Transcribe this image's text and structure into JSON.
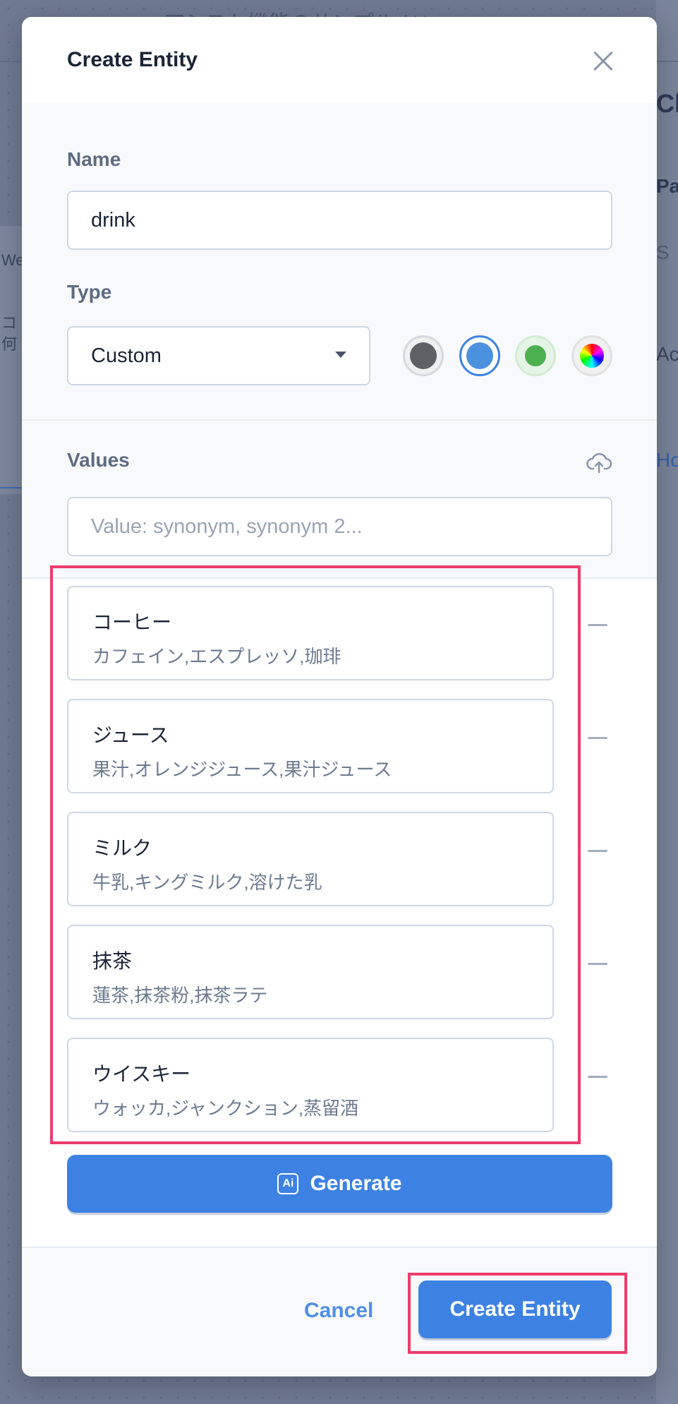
{
  "background": {
    "breadcrumb": "アシスト機能のサンプル / Home",
    "right_peek": [
      "Ch",
      "Pat",
      "S",
      "Act",
      "How"
    ],
    "left_peek": [
      "We",
      "コ",
      "何"
    ]
  },
  "modal": {
    "title": "Create Entity",
    "name_label": "Name",
    "name_value": "drink",
    "type_label": "Type",
    "type_value": "Custom",
    "colors": [
      {
        "name": "gray",
        "color": "#5d6166",
        "selected": false
      },
      {
        "name": "blue",
        "color": "#4b91de",
        "selected": true
      },
      {
        "name": "green",
        "color": "#4caf50",
        "selected": false
      },
      {
        "name": "rainbow",
        "color": "conic",
        "selected": false
      }
    ],
    "values_label": "Values",
    "values_placeholder": "Value: synonym, synonym 2...",
    "values": [
      {
        "name": "コーヒー",
        "synonyms": "カフェイン,エスプレッソ,珈琲"
      },
      {
        "name": "ジュース",
        "synonyms": "果汁,オレンジジュース,果汁ジュース"
      },
      {
        "name": "ミルク",
        "synonyms": "牛乳,キングミルク,溶けた乳"
      },
      {
        "name": "抹茶",
        "synonyms": "蓮茶,抹茶粉,抹茶ラテ"
      },
      {
        "name": "ウイスキー",
        "synonyms": "ウォッカ,ジャンクション,蒸留酒"
      }
    ],
    "generate_label": "Generate",
    "ai_icon_text": "Ai",
    "cancel_label": "Cancel",
    "create_label": "Create Entity"
  }
}
